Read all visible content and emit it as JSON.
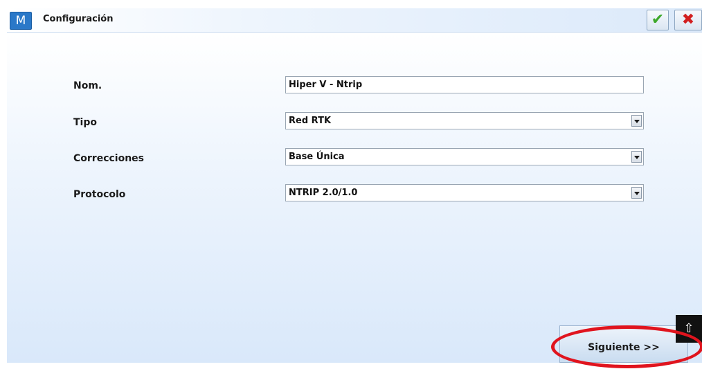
{
  "window": {
    "logo_letter": "M",
    "title": "Configuración",
    "ok_symbol": "✔",
    "cancel_symbol": "✖"
  },
  "form": {
    "fields": [
      {
        "label": "Nom.",
        "value": "Hiper V - Ntrip",
        "type": "text"
      },
      {
        "label": "Tipo",
        "value": "Red RTK",
        "type": "select"
      },
      {
        "label": "Correcciones",
        "value": "Base Única",
        "type": "select"
      },
      {
        "label": "Protocolo",
        "value": "NTRIP 2.0/1.0",
        "type": "select"
      }
    ]
  },
  "footer": {
    "next_label": "Siguiente >>",
    "keyboard_symbol": "⇧"
  },
  "colors": {
    "accent": "#2a78c8",
    "ok": "#3da82a",
    "cancel": "#d21f1f",
    "highlight": "#e0141e"
  }
}
